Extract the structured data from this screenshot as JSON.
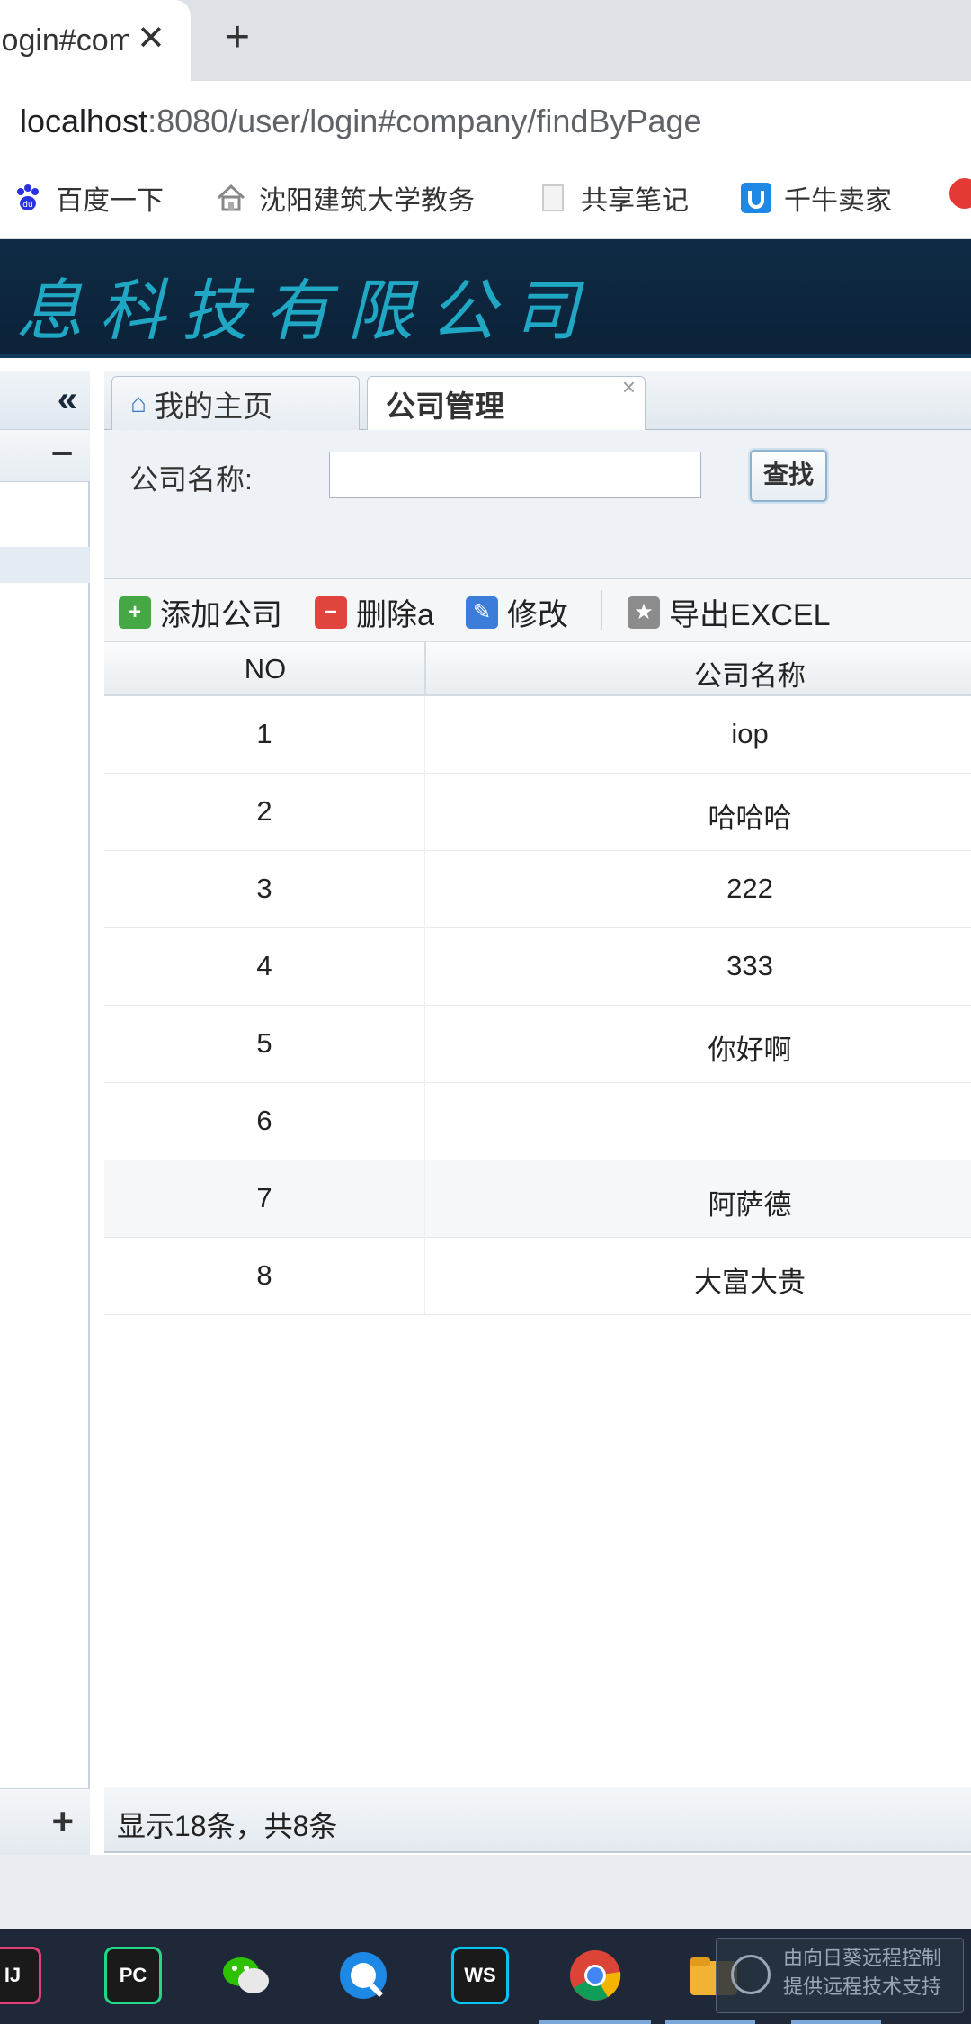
{
  "browser": {
    "tab_title": "login#company/findByPage",
    "tab_close": "✕",
    "new_tab": "+",
    "url_host": "localhost",
    "url_rest": ":8080/user/login#company/findByPage",
    "bookmarks": [
      {
        "label": "百度一下",
        "icon": "baidu-paw-icon"
      },
      {
        "label": "沈阳建筑大学教务",
        "icon": "house-icon"
      },
      {
        "label": "共享笔记",
        "icon": "page-icon"
      },
      {
        "label": "千牛卖家",
        "icon": "qianniu-icon"
      }
    ]
  },
  "header": {
    "company_title": "息科技有限公司"
  },
  "left_panel": {
    "collapse": "«",
    "minus": "−",
    "plus": "+"
  },
  "tabs": [
    {
      "label": "我的主页",
      "icon": "home-icon"
    },
    {
      "label": "公司管理",
      "close": "×"
    }
  ],
  "search": {
    "label": "公司名称:",
    "value": "",
    "button": "查找"
  },
  "toolbar": {
    "add": "添加公司",
    "delete": "删除a",
    "edit": "修改",
    "export": "导出EXCEL"
  },
  "grid": {
    "columns": [
      "NO",
      "公司名称"
    ],
    "rows": [
      {
        "no": "1",
        "name": "iop"
      },
      {
        "no": "2",
        "name": "哈哈哈"
      },
      {
        "no": "3",
        "name": "222"
      },
      {
        "no": "4",
        "name": "333"
      },
      {
        "no": "5",
        "name": "你好啊"
      },
      {
        "no": "6",
        "name": ""
      },
      {
        "no": "7",
        "name": "阿萨德"
      },
      {
        "no": "8",
        "name": "大富大贵"
      }
    ]
  },
  "pager": {
    "text": "显示18条，共8条"
  },
  "taskbar": {
    "apps": [
      "IJ",
      "PC",
      "wechat-icon",
      "qq-browser-icon",
      "WS",
      "chrome-icon",
      "folder-icon"
    ],
    "remote_text": "由向日葵远程控制 提供远程技术支持"
  },
  "colors": {
    "banner_bg": "#0f2b45",
    "banner_text": "#1fa7c4",
    "taskbar_bg": "#1e2838",
    "add_icon": "#45a845",
    "delete_icon": "#e0443c",
    "edit_icon": "#3b7dd8",
    "export_icon": "#8c8c8c"
  }
}
